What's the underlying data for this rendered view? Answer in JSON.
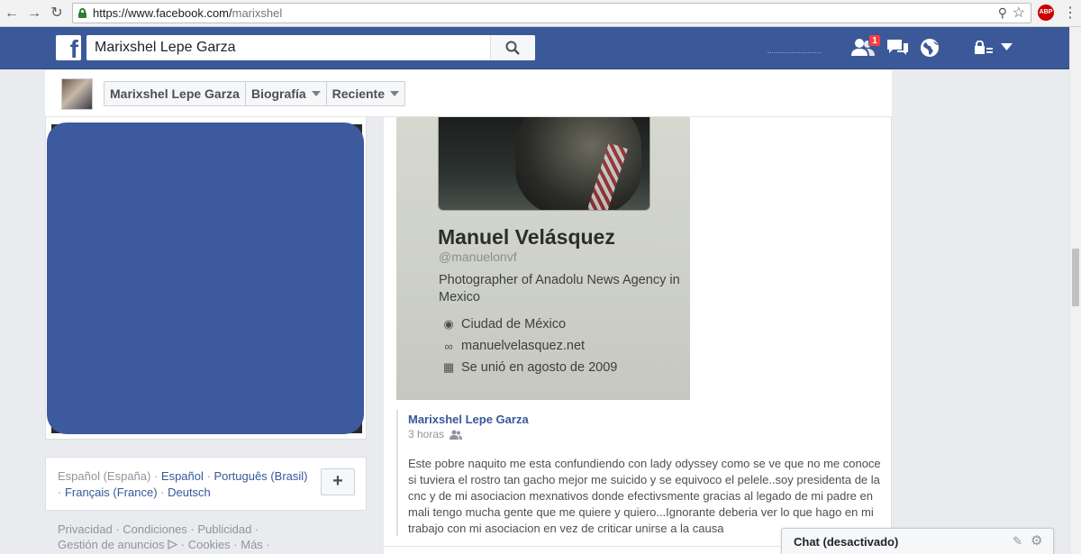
{
  "browser": {
    "url_prefix": "https://www.facebook.com/",
    "url_path": "marixshel",
    "icons": [
      "back-arrow",
      "forward-arrow",
      "reload",
      "lock",
      "zoom",
      "star",
      "adblock-plus",
      "menu"
    ],
    "abp_label": "ABP"
  },
  "topbar": {
    "logo_letter": "f",
    "search_value": "Marixshel Lepe Garza",
    "friend_request_badge": "1",
    "colors": {
      "bar": "#3b5998",
      "badge": "#fa3e3e"
    }
  },
  "subnav": {
    "profile_name": "Marixshel Lepe Garza",
    "timeline_label": "Biografía",
    "recent_label": "Reciente"
  },
  "languages": {
    "current": "Español (España)",
    "options": [
      "Español",
      "Português (Brasil)",
      "Français (France)",
      "Deutsch"
    ],
    "add_label": "+"
  },
  "footer": {
    "line1": [
      "Privacidad",
      "Condiciones",
      "Publicidad"
    ],
    "line2": [
      "Gestión de anuncios",
      "Cookies",
      "Más"
    ]
  },
  "shared_image": {
    "name": "Manuel Velásquez",
    "handle": "@manuelonvf",
    "bio": "Photographer of Anadolu News Agency in Mexico",
    "location": "Ciudad de México",
    "website": "manuelvelasquez.net",
    "joined": "Se unió en agosto de 2009"
  },
  "comment": {
    "author": "Marixshel Lepe Garza",
    "time": "3 horas",
    "body": "Este pobre naquito me esta confundiendo con lady odyssey como se ve que no me conoce si tuviera el rostro tan gacho mejor me suicido y se equivoco el pelele..soy presidenta de la cnc y de mi asociacion mexnativos donde efectivsmente gracias al legado de mi padre en mali tengo mucha gente que me quiere y quiero...Ignorante deberia ver lo que hago en mi trabajo con mi asociacion en vez de criticar unirse a la causa"
  },
  "chat": {
    "title": "Chat (desactivado)"
  }
}
